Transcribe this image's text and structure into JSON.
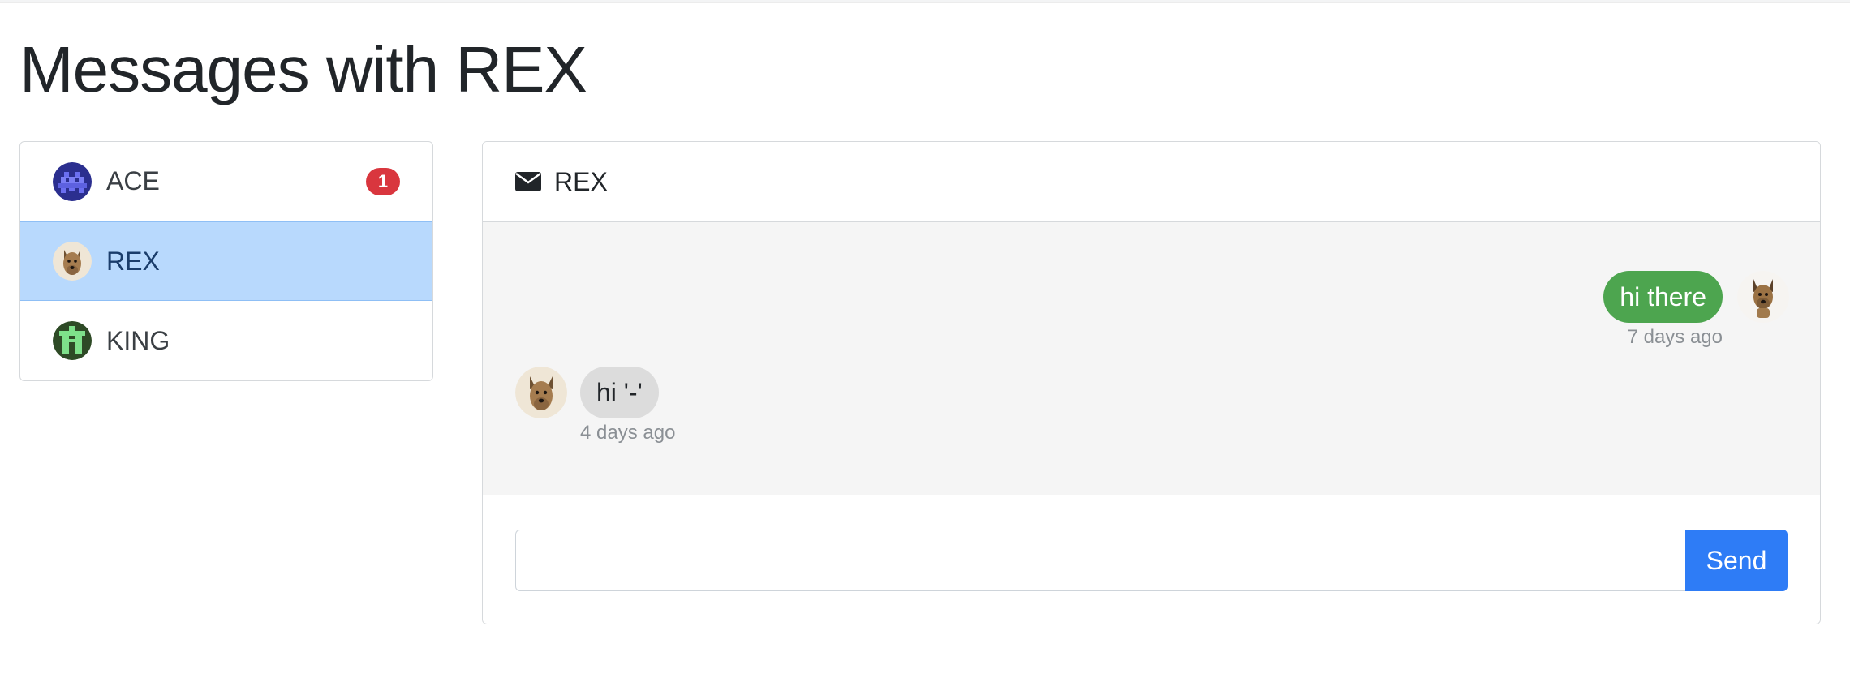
{
  "page": {
    "title": "Messages with REX"
  },
  "conversations": [
    {
      "name": "ACE",
      "unread": "1",
      "avatar_icon": "space-invader-avatar-icon",
      "active": false
    },
    {
      "name": "REX",
      "unread": "",
      "avatar_icon": "dog-avatar-icon",
      "active": true
    },
    {
      "name": "KING",
      "unread": "",
      "avatar_icon": "pixel-king-avatar-icon",
      "active": false
    }
  ],
  "chat": {
    "header_icon": "envelope-icon",
    "header_name": "REX",
    "messages": [
      {
        "direction": "sent",
        "text": "hi there",
        "time": "7 days ago"
      },
      {
        "direction": "received",
        "text": "hi '-'",
        "time": "4 days ago"
      }
    ],
    "input": {
      "value": "",
      "placeholder": ""
    },
    "send_label": "Send"
  },
  "colors": {
    "active_item_bg": "#b8d9fd",
    "badge": "#d9363e",
    "sent_bubble": "#4da54f",
    "received_bubble": "#dcdcdc",
    "send_button": "#2e7cf6",
    "chat_body_bg": "#f5f5f5"
  }
}
